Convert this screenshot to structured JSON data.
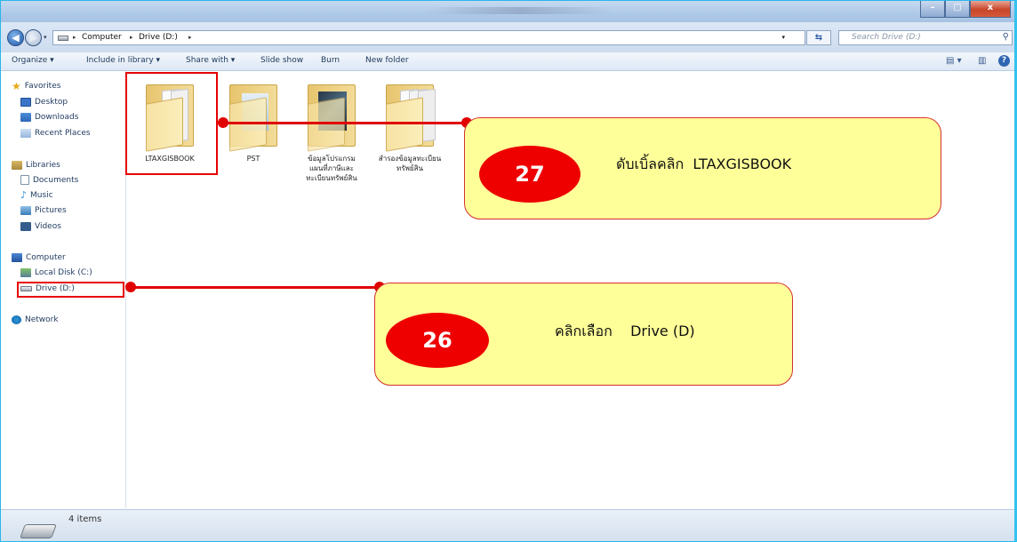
{
  "window": {
    "buttons": {
      "min": "–",
      "max": "▢",
      "close": "x"
    }
  },
  "address": {
    "crumbs": [
      "Computer",
      "Drive (D:)"
    ],
    "separator": "▸",
    "search_placeholder": "Search Drive (D:)"
  },
  "toolbar": {
    "organize": "Organize ▾",
    "include_in_library": "Include in library ▾",
    "share_with": "Share with ▾",
    "slide_show": "Slide show",
    "burn": "Burn",
    "new_folder": "New folder"
  },
  "nav": {
    "favorites": "Favorites",
    "desktop": "Desktop",
    "downloads": "Downloads",
    "recent_places": "Recent Places",
    "libraries": "Libraries",
    "documents": "Documents",
    "music": "Music",
    "pictures": "Pictures",
    "videos": "Videos",
    "computer": "Computer",
    "local_disk": "Local Disk (C:)",
    "drive_d": "Drive (D:)",
    "network": "Network"
  },
  "folders": [
    {
      "name": "LTAXGISBOOK",
      "name_line2": ""
    },
    {
      "name": "PST",
      "name_line2": ""
    },
    {
      "name": "ข้อมูลโปรแกรม",
      "name_line2": "แผนที่ภาษีและ",
      "name_line3": "ทะเบียนทรัพย์สิน"
    },
    {
      "name": "สำรองข้อมูลทะเบียน",
      "name_line2": "ทรัพย์สิน",
      "name_line3": ""
    }
  ],
  "annotations": {
    "step27": {
      "number": "27",
      "text": "ดับเบิ้ลคลิก  LTAXGISBOOK"
    },
    "step26": {
      "number": "26",
      "text": "คลิกเลือก    Drive (D)"
    }
  },
  "status": {
    "items_count": "4 items"
  },
  "colors": {
    "callout_fill": "#ffff99",
    "badge": "#ee0000",
    "frame_accent": "#29b6e9"
  }
}
